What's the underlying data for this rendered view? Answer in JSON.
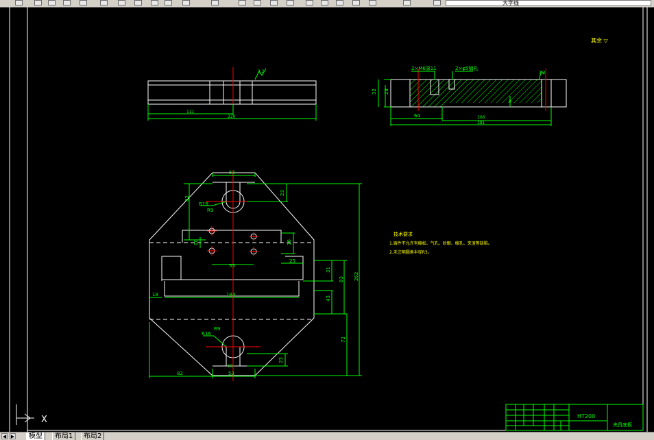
{
  "toolbar": {
    "layer_combo_value": "大字线",
    "icons": [
      "save-icon",
      "print-icon",
      "preview-icon",
      "publish-icon",
      "cut-icon",
      "copy-icon",
      "paste-icon",
      "match-properties-icon",
      "undo-icon",
      "redo-icon",
      "pan-icon",
      "zoom-realtime-icon",
      "zoom-window-icon",
      "zoom-previous-icon",
      "properties-icon",
      "design-center-icon",
      "tool-palettes-icon",
      "sheet-set-icon",
      "markup-icon",
      "calculator-icon",
      "help-icon",
      "layer-manager-icon",
      "layer-state-icon"
    ]
  },
  "tabs": {
    "nav_first": "◀",
    "nav_prev": "▶",
    "model": "模型",
    "layout1": "布局1",
    "layout2": "布局2"
  },
  "drawing": {
    "roughness_note": "其余 ▽",
    "top_view": {
      "dim_111": "111",
      "dim_220": "220",
      "roughness": "3.2"
    },
    "section_view": {
      "label_m6": "2×M6深11",
      "label_hole": "2×φ5销孔",
      "dim_32": "32",
      "dim_28": "28",
      "dim_64": "64",
      "dim_166": "166",
      "dim_181": "181",
      "dim_9": "9",
      "roughness": "3.2"
    },
    "plan_view": {
      "dim_53_top": "53",
      "dim_23_top": "23",
      "dim_82_left": "82",
      "dim_R16_top": "R16",
      "dim_R9_top": "R9",
      "dim_20": "20",
      "dim_16": "16",
      "dim_55": "55",
      "dim_25": "25",
      "dim_31": "31",
      "dim_83": "83",
      "dim_262": "262",
      "dim_18": "18",
      "dim_183": "183",
      "dim_43": "43",
      "dim_72": "72",
      "dim_R16_bot": "R16",
      "dim_R9_bot": "R9",
      "dim_18_bot": "18",
      "dim_23_bot": "23",
      "dim_82_bot": "82",
      "dim_53_bot": "53"
    },
    "notes": {
      "title": "技术要求",
      "line1": "1.铸件不允许有缩松、气孔、砂眼、缩孔、夹渣等缺陷。",
      "line2": "2.未注明圆角半径R3。"
    },
    "title_block": {
      "material": "HT200",
      "part_name": "夹具底板"
    },
    "ucs": {
      "x_label": "X"
    }
  }
}
